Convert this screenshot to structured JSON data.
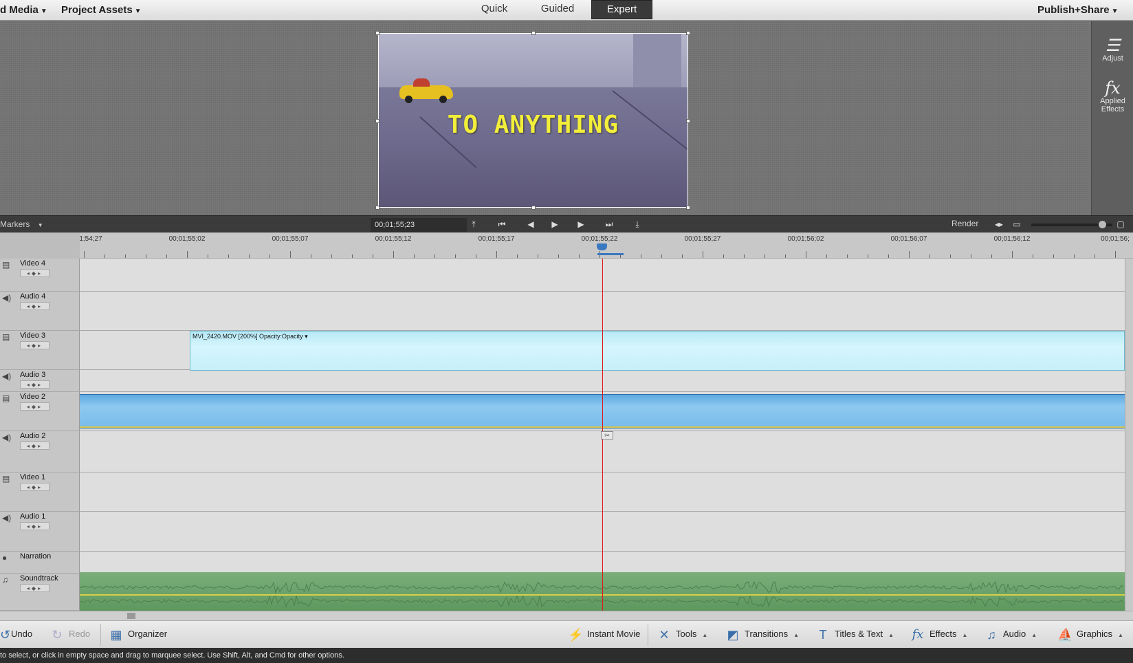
{
  "topbar": {
    "add_media": "d Media",
    "project_assets": "Project Assets",
    "modes": [
      "Quick",
      "Guided",
      "Expert"
    ],
    "active_mode": "Expert",
    "publish_share": "Publish+Share"
  },
  "monitor": {
    "title_text": "TO ANYTHING"
  },
  "right_panel": {
    "adjust_label": "Adjust",
    "effects_label_1": "Applied",
    "effects_label_2": "Effects"
  },
  "transport": {
    "markers_label": "Markers",
    "timecode": "00;01;55;23",
    "render_label": "Render",
    "zoom_level": 0.92
  },
  "ruler": {
    "labels": [
      "1;54;27",
      "00;01;55;02",
      "00;01;55;07",
      "00;01;55;12",
      "00;01;55;17",
      "00;01;55;22",
      "00;01;55;27",
      "00;01;56;02",
      "00;01;56;07",
      "00;01;56;12",
      "00;01;56;"
    ]
  },
  "tracks": [
    {
      "name": "Video 4",
      "kind": "video"
    },
    {
      "name": "Audio 4",
      "kind": "audio"
    },
    {
      "name": "Video 3",
      "kind": "video"
    },
    {
      "name": "Audio 3",
      "kind": "audio"
    },
    {
      "name": "Video 2",
      "kind": "video"
    },
    {
      "name": "Audio 2",
      "kind": "audio"
    },
    {
      "name": "Video 1",
      "kind": "video"
    },
    {
      "name": "Audio 1",
      "kind": "audio"
    },
    {
      "name": "Narration",
      "kind": "narration"
    },
    {
      "name": "Soundtrack",
      "kind": "soundtrack"
    }
  ],
  "clips": {
    "video3_label": "MVI_2420.MOV [200%]  Opacity:Opacity ▾"
  },
  "actionbar": {
    "undo": "Undo",
    "redo": "Redo",
    "organizer": "Organizer",
    "instant_movie": "Instant Movie",
    "tools": "Tools",
    "transitions": "Transitions",
    "titles_text": "Titles & Text",
    "effects": "Effects",
    "audio": "Audio",
    "graphics": "Graphics"
  },
  "status": {
    "text": "to select, or click in empty space and drag to marquee select. Use Shift, Alt, and Cmd for other options."
  },
  "colors": {
    "playhead": "#e01818",
    "clip_blue": "#78bbea",
    "clip_light": "#c6f0fa",
    "soundtrack_green": "#6aa26a",
    "title_yellow": "#f2ee3a"
  }
}
